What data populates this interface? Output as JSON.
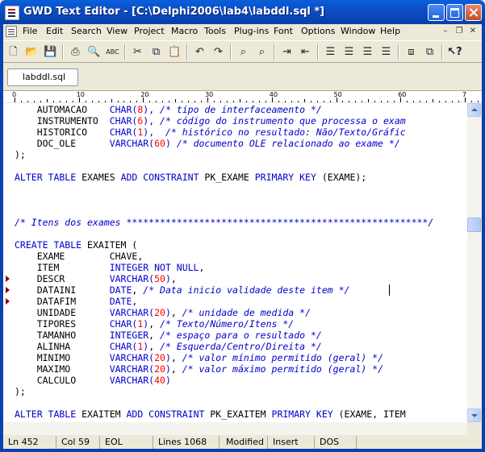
{
  "window": {
    "title": "GWD Text Editor - [C:\\Delphi2006\\lab4\\labddl.sql *]"
  },
  "menu": [
    "File",
    "Edit",
    "Search",
    "View",
    "Project",
    "Macro",
    "Tools",
    "Plug-ins",
    "Font",
    "Options",
    "Window",
    "Help"
  ],
  "tabs": [
    {
      "label": "labddl.sql"
    }
  ],
  "ruler": {
    "labels": [
      "0",
      "10",
      "20",
      "30",
      "40",
      "50",
      "60",
      "7"
    ]
  },
  "status": {
    "line": "Ln 452",
    "col": "Col 59",
    "eol": "EOL",
    "lines": "Lines 1068",
    "modified": "Modified",
    "insert": "Insert",
    "format": "DOS"
  },
  "code": [
    [
      "    AUTOMACAO    ",
      [
        "kw",
        "CHAR("
      ],
      [
        "num",
        "8"
      ],
      [
        "kw",
        "), "
      ],
      [
        "cmt",
        "/* tipo de interfaceamento */"
      ]
    ],
    [
      "    INSTRUMENTO  ",
      [
        "kw",
        "CHAR("
      ],
      [
        "num",
        "6"
      ],
      [
        "kw",
        "), "
      ],
      [
        "cmt",
        "/* código do instrumento que processa o exam"
      ]
    ],
    [
      "    HISTORICO    ",
      [
        "kw",
        "CHAR("
      ],
      [
        "num",
        "1"
      ],
      [
        "kw",
        "),  "
      ],
      [
        "cmt",
        "/* histórico no resultado: Não/Texto/Gráfic"
      ]
    ],
    [
      "    DOC_OLE      ",
      [
        "kw",
        "VARCHAR("
      ],
      [
        "num",
        "60"
      ],
      [
        "kw",
        ") "
      ],
      [
        "cmt",
        "/* documento OLE relacionado ao exame */"
      ]
    ],
    [
      ");"
    ],
    [
      ""
    ],
    [
      [
        "kw",
        "ALTER TABLE"
      ],
      " EXAMES ",
      [
        "kw",
        "ADD CONSTRAINT"
      ],
      " PK_EXAME ",
      [
        "kw",
        "PRIMARY KEY"
      ],
      " (EXAME);"
    ],
    [
      ""
    ],
    [
      ""
    ],
    [
      ""
    ],
    [
      [
        "cmt",
        "/* Itens dos exames ******************************************************/"
      ]
    ],
    [
      ""
    ],
    [
      [
        "kw",
        "CREATE TABLE"
      ],
      " EXAITEM ("
    ],
    [
      "    EXAME        CHAVE,"
    ],
    [
      "    ITEM         ",
      [
        "kw",
        "INTEGER NOT NULL"
      ],
      ","
    ],
    [
      "    DESCR        ",
      [
        "kw",
        "VARCHAR("
      ],
      [
        "num",
        "50"
      ],
      [
        "kw",
        ")"
      ],
      ","
    ],
    [
      "    DATAINI      ",
      [
        "kw",
        "DATE"
      ],
      ", ",
      [
        "cmt",
        "/* Data inicio validade deste item */"
      ]
    ],
    [
      "    DATAFIM      ",
      [
        "kw",
        "DATE"
      ],
      ","
    ],
    [
      "    UNIDADE      ",
      [
        "kw",
        "VARCHAR("
      ],
      [
        "num",
        "20"
      ],
      [
        "kw",
        ")"
      ],
      ", ",
      [
        "cmt",
        "/* unidade de medida */"
      ]
    ],
    [
      "    TIPORES      ",
      [
        "kw",
        "CHAR("
      ],
      [
        "num",
        "1"
      ],
      [
        "kw",
        ")"
      ],
      ", ",
      [
        "cmt",
        "/* Texto/Número/Itens */"
      ]
    ],
    [
      "    TAMANHO      ",
      [
        "kw",
        "INTEGER"
      ],
      ", ",
      [
        "cmt",
        "/* espaço para o resultado */"
      ]
    ],
    [
      "    ALINHA       ",
      [
        "kw",
        "CHAR("
      ],
      [
        "num",
        "1"
      ],
      [
        "kw",
        ")"
      ],
      ", ",
      [
        "cmt",
        "/* Esquerda/Centro/Direita */"
      ]
    ],
    [
      "    MINIMO       ",
      [
        "kw",
        "VARCHAR("
      ],
      [
        "num",
        "20"
      ],
      [
        "kw",
        ")"
      ],
      ", ",
      [
        "cmt",
        "/* valor mínimo permitido (geral) */"
      ]
    ],
    [
      "    MAXIMO       ",
      [
        "kw",
        "VARCHAR("
      ],
      [
        "num",
        "20"
      ],
      [
        "kw",
        ")"
      ],
      ", ",
      [
        "cmt",
        "/* valor máximo permitido (geral) */"
      ]
    ],
    [
      "    CALCULO      ",
      [
        "kw",
        "VARCHAR("
      ],
      [
        "num",
        "40"
      ],
      [
        "kw",
        ")"
      ]
    ],
    [
      ");"
    ],
    [
      ""
    ],
    [
      [
        "kw",
        "ALTER TABLE"
      ],
      " EXAITEM ",
      [
        "kw",
        "ADD CONSTRAINT"
      ],
      " PK_EXAITEM ",
      [
        "kw",
        "PRIMARY KEY"
      ],
      " (EXAME, ITEM"
    ]
  ]
}
